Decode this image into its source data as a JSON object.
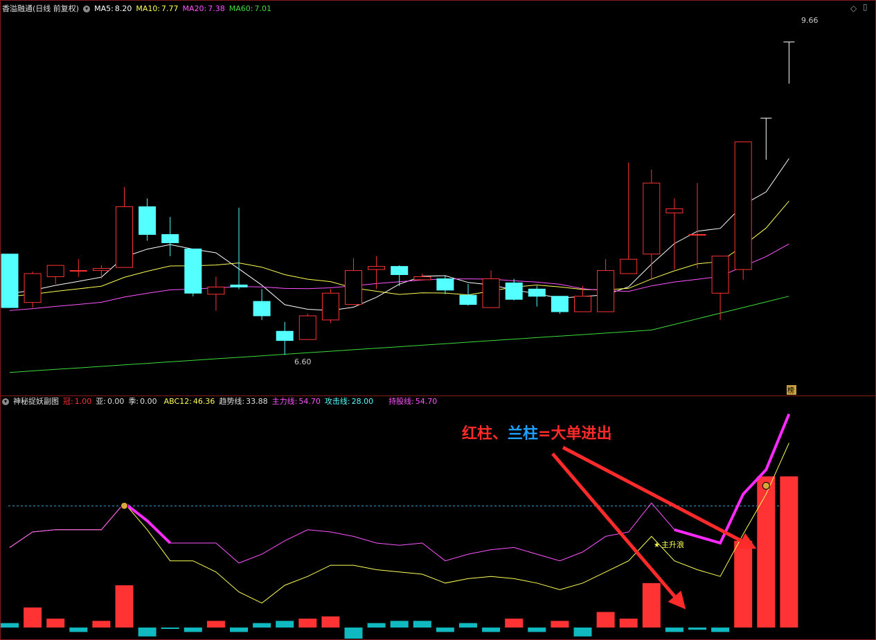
{
  "main_header": {
    "stock": "香溢融通",
    "period": "(日线 前复权)",
    "ma5_label": "MA5:",
    "ma5_value": "8.20",
    "ma10_label": "MA10:",
    "ma10_value": "7.77",
    "ma20_label": "MA20:",
    "ma20_value": "7.38",
    "ma60_label": "MA60:",
    "ma60_value": "7.01"
  },
  "sub_header": {
    "title": "神秘捉妖副图",
    "guan_label": "冠:",
    "guan_value": "1.00",
    "ya_label": "亚:",
    "ya_value": "0.00",
    "ji_label": "季:",
    "ji_value": "0.00",
    "abc_label": "ABC12:",
    "abc_value": "46.36",
    "trend_label": "趋势线:",
    "trend_value": "33.88",
    "main_label": "主力线:",
    "main_value": "54.70",
    "attack_label": "攻击线:",
    "attack_value": "28.00",
    "hold_label": "持股线:",
    "hold_value": "54.70"
  },
  "annotation": {
    "part1": "红柱、",
    "part2": "兰柱",
    "part3": "=大单进出",
    "signal": "主升浪",
    "high_label": "9.66",
    "low_label": "6.60",
    "corner_tag": "榜"
  },
  "colors": {
    "up": "#ff3333",
    "down": "#54ffff",
    "ma5": "#ffffff",
    "ma10": "#ffff54",
    "ma20": "#ff54ff",
    "ma60": "#3cdc3c",
    "annot_red": "#ff2a2a",
    "annot_blue": "#1ea0ff"
  },
  "chart_data": [
    {
      "type": "candlestick",
      "title": "香溢融通 (日线 前复权)",
      "price_range": [
        6.3,
        9.9
      ],
      "candles": [
        {
          "o": 7.6,
          "h": 7.6,
          "l": 7.08,
          "c": 7.08
        },
        {
          "o": 7.13,
          "h": 7.43,
          "l": 7.08,
          "c": 7.41
        },
        {
          "o": 7.38,
          "h": 7.49,
          "l": 7.31,
          "c": 7.49
        },
        {
          "o": 7.44,
          "h": 7.55,
          "l": 7.38,
          "c": 7.44
        },
        {
          "o": 7.44,
          "h": 7.49,
          "l": 7.36,
          "c": 7.46
        },
        {
          "o": 7.47,
          "h": 8.25,
          "l": 7.47,
          "c": 8.06
        },
        {
          "o": 8.06,
          "h": 8.14,
          "l": 7.73,
          "c": 7.79
        },
        {
          "o": 7.79,
          "h": 7.96,
          "l": 7.58,
          "c": 7.71
        },
        {
          "o": 7.65,
          "h": 7.65,
          "l": 7.19,
          "c": 7.22
        },
        {
          "o": 7.21,
          "h": 7.38,
          "l": 7.05,
          "c": 7.28
        },
        {
          "o": 7.3,
          "h": 8.05,
          "l": 7.26,
          "c": 7.28
        },
        {
          "o": 7.14,
          "h": 7.26,
          "l": 6.96,
          "c": 7.0
        },
        {
          "o": 6.85,
          "h": 6.94,
          "l": 6.62,
          "c": 6.76
        },
        {
          "o": 6.77,
          "h": 7.02,
          "l": 6.77,
          "c": 7.0
        },
        {
          "o": 6.96,
          "h": 7.26,
          "l": 6.93,
          "c": 7.22
        },
        {
          "o": 7.11,
          "h": 7.56,
          "l": 7.11,
          "c": 7.44
        },
        {
          "o": 7.45,
          "h": 7.58,
          "l": 7.26,
          "c": 7.48
        },
        {
          "o": 7.48,
          "h": 7.49,
          "l": 7.29,
          "c": 7.4
        },
        {
          "o": 7.35,
          "h": 7.41,
          "l": 7.35,
          "c": 7.38
        },
        {
          "o": 7.36,
          "h": 7.39,
          "l": 7.21,
          "c": 7.25
        },
        {
          "o": 7.2,
          "h": 7.31,
          "l": 7.1,
          "c": 7.11
        },
        {
          "o": 7.08,
          "h": 7.44,
          "l": 7.08,
          "c": 7.36
        },
        {
          "o": 7.32,
          "h": 7.36,
          "l": 7.15,
          "c": 7.16
        },
        {
          "o": 7.26,
          "h": 7.29,
          "l": 7.09,
          "c": 7.19
        },
        {
          "o": 7.19,
          "h": 7.19,
          "l": 7.02,
          "c": 7.04
        },
        {
          "o": 7.04,
          "h": 7.29,
          "l": 7.04,
          "c": 7.19
        },
        {
          "o": 7.04,
          "h": 7.55,
          "l": 7.04,
          "c": 7.44
        },
        {
          "o": 7.41,
          "h": 8.49,
          "l": 7.41,
          "c": 7.55
        },
        {
          "o": 7.6,
          "h": 8.42,
          "l": 7.35,
          "c": 8.29
        },
        {
          "o": 8.0,
          "h": 8.14,
          "l": 7.45,
          "c": 8.04
        },
        {
          "o": 7.79,
          "h": 8.29,
          "l": 7.46,
          "c": 7.79
        },
        {
          "o": 7.22,
          "h": 7.58,
          "l": 6.96,
          "c": 7.58
        },
        {
          "o": 7.45,
          "h": 8.69,
          "l": 7.35,
          "c": 8.69
        },
        {
          "o": 8.92,
          "h": 8.92,
          "l": 8.92,
          "c": 8.92
        },
        {
          "o": 9.66,
          "h": 9.66,
          "l": 9.66,
          "c": 9.66
        }
      ],
      "ma_periods": [
        5,
        10,
        20,
        60
      ]
    },
    {
      "type": "bar+line",
      "title": "神秘捉妖副图",
      "y_range": [
        0,
        100
      ],
      "reference_line": 54.7,
      "bars": [
        2,
        9,
        4,
        -2,
        3,
        19,
        -4,
        0,
        -2,
        3,
        -2,
        2,
        3,
        4,
        5,
        -5,
        2,
        3,
        3,
        -2,
        2,
        -2,
        4,
        -2,
        3,
        -4,
        7,
        4,
        20,
        -2,
        -1,
        -2,
        39,
        68,
        68
      ],
      "bar_colors": [
        "down",
        "up",
        "up",
        "down",
        "up",
        "up",
        "down",
        "down",
        "down",
        "up",
        "down",
        "down",
        "down",
        "up",
        "up",
        "down",
        "down",
        "down",
        "down",
        "down",
        "down",
        "down",
        "up",
        "down",
        "up",
        "down",
        "up",
        "up",
        "up",
        "down",
        "down",
        "down",
        "up",
        "up",
        "up"
      ],
      "main_line": [
        36,
        43,
        44,
        44,
        44,
        56,
        48,
        38,
        38,
        38,
        29,
        33,
        39,
        44,
        43,
        41,
        38,
        37,
        38,
        30,
        33,
        35,
        36,
        33,
        30,
        34,
        41,
        43,
        56,
        44,
        41,
        38,
        60,
        71,
        96
      ],
      "attack_line": [
        36,
        43,
        44,
        44,
        44,
        56,
        44,
        30,
        30,
        25,
        16,
        11,
        19,
        23,
        28,
        28,
        26,
        25,
        24,
        20,
        22,
        23,
        22,
        20,
        17,
        20,
        25,
        30,
        41,
        30,
        26,
        23,
        42,
        60,
        83
      ]
    }
  ]
}
